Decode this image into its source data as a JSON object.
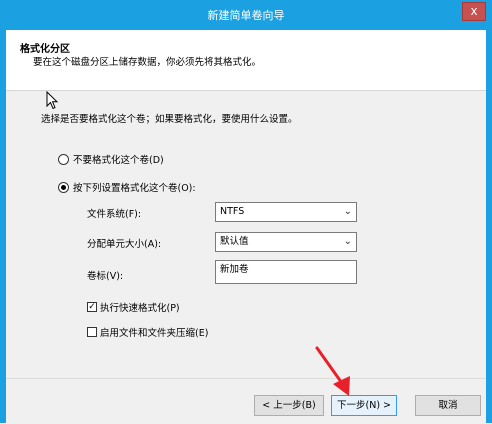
{
  "window": {
    "title": "新建简单卷向导",
    "close_symbol": "x"
  },
  "header": {
    "title": "格式化分区",
    "subtitle": "要在这个磁盘分区上储存数据，你必须先将其格式化。"
  },
  "main": {
    "prompt": "选择是否要格式化这个卷；如果要格式化，要使用什么设置。",
    "options": {
      "no_format": {
        "label": "不要格式化这个卷(D)",
        "selected": false
      },
      "format": {
        "label": "按下列设置格式化这个卷(O):",
        "selected": true
      }
    },
    "filesystem": {
      "label": "文件系统(F):",
      "value": "NTFS"
    },
    "allocation": {
      "label": "分配单元大小(A):",
      "value": "默认值"
    },
    "volume_label": {
      "label": "卷标(V):",
      "value": "新加卷"
    },
    "quick_format": {
      "label": "执行快速格式化(P)",
      "checked": true
    },
    "compression": {
      "label": "启用文件和文件夹压缩(E)",
      "checked": false
    }
  },
  "footer": {
    "back": "< 上一步(B)",
    "next": "下一步(N) >",
    "cancel": "取消"
  },
  "colors": {
    "titlebar": "#1ba1e2",
    "annotation_arrow": "#e8202a",
    "close": "#c75050"
  }
}
